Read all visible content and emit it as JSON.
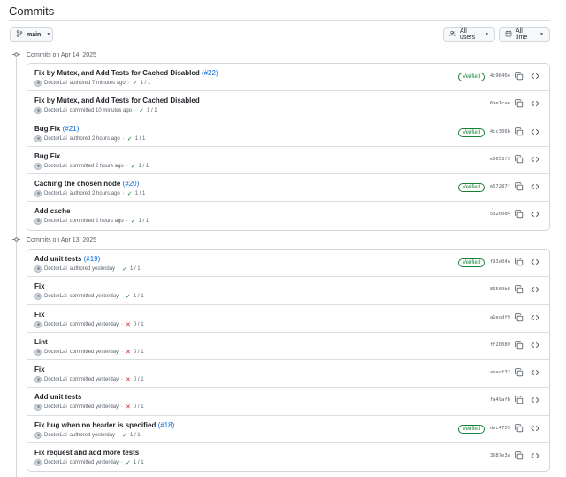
{
  "page": {
    "title": "Commits"
  },
  "toolbar": {
    "branch_label": "main",
    "users_label": "All users",
    "time_label": "All time"
  },
  "colors": {
    "verified": "#1a7f37",
    "success": "#1a7f37",
    "failure": "#cf222e",
    "link": "#0969da"
  },
  "groups": [
    {
      "date_label": "Commits on Apr 14, 2025",
      "commits": [
        {
          "title": "Fix by Mutex, and Add Tests for Cached Disabled",
          "pr": "(#22)",
          "author": "DoctorLai",
          "action": "authored 7 minutes ago",
          "status": "success",
          "check_icon": "✓",
          "checks": "1 / 1",
          "verified": "Verified",
          "sha": "4c9846e"
        },
        {
          "title": "Fix by Mutex, and Add Tests for Cached Disabled",
          "pr": "",
          "author": "DoctorLai",
          "action": "committed 10 minutes ago",
          "status": "success",
          "check_icon": "✓",
          "checks": "1 / 1",
          "verified": "",
          "sha": "6be1cae"
        },
        {
          "title": "Bug Fix",
          "pr": "(#21)",
          "author": "DoctorLai",
          "action": "authored 2 hours ago",
          "status": "success",
          "check_icon": "✓",
          "checks": "1 / 1",
          "verified": "Verified",
          "sha": "4cc306b"
        },
        {
          "title": "Bug Fix",
          "pr": "",
          "author": "DoctorLai",
          "action": "committed 2 hours ago",
          "status": "success",
          "check_icon": "✓",
          "checks": "1 / 1",
          "verified": "",
          "sha": "e0653f3"
        },
        {
          "title": "Caching the chosen node",
          "pr": "(#20)",
          "author": "DoctorLai",
          "action": "authored 2 hours ago",
          "status": "success",
          "check_icon": "✓",
          "checks": "1 / 1",
          "verified": "Verified",
          "sha": "e57287f"
        },
        {
          "title": "Add cache",
          "pr": "",
          "author": "DoctorLai",
          "action": "committed 2 hours ago",
          "status": "success",
          "check_icon": "✓",
          "checks": "1 / 1",
          "verified": "",
          "sha": "53200d4"
        }
      ]
    },
    {
      "date_label": "Commits on Apr 13, 2025",
      "commits": [
        {
          "title": "Add unit tests",
          "pr": "(#19)",
          "author": "DoctorLai",
          "action": "authored yesterday",
          "status": "success",
          "check_icon": "✓",
          "checks": "1 / 1",
          "verified": "Verified",
          "sha": "f93a04a"
        },
        {
          "title": "Fix",
          "pr": "",
          "author": "DoctorLai",
          "action": "committed yesterday",
          "status": "success",
          "check_icon": "✓",
          "checks": "1 / 1",
          "verified": "",
          "sha": "86509b8"
        },
        {
          "title": "Fix",
          "pr": "",
          "author": "DoctorLai",
          "action": "committed yesterday",
          "status": "failure",
          "check_icon": "✕",
          "checks": "0 / 1",
          "verified": "",
          "sha": "a1ecdf9"
        },
        {
          "title": "Lint",
          "pr": "",
          "author": "DoctorLai",
          "action": "committed yesterday",
          "status": "failure",
          "check_icon": "✕",
          "checks": "0 / 1",
          "verified": "",
          "sha": "ff20089"
        },
        {
          "title": "Fix",
          "pr": "",
          "author": "DoctorLai",
          "action": "committed yesterday",
          "status": "failure",
          "check_icon": "✕",
          "checks": "0 / 1",
          "verified": "",
          "sha": "abaaf32"
        },
        {
          "title": "Add unit tests",
          "pr": "",
          "author": "DoctorLai",
          "action": "committed yesterday",
          "status": "failure",
          "check_icon": "✕",
          "checks": "0 / 1",
          "verified": "",
          "sha": "fa49afb"
        },
        {
          "title": "Fix bug when no header is specified",
          "pr": "(#18)",
          "author": "DoctorLai",
          "action": "authored yesterday",
          "status": "success",
          "check_icon": "✓",
          "checks": "1 / 1",
          "verified": "Verified",
          "sha": "dec4755"
        },
        {
          "title": "Fix request and add more tests",
          "pr": "",
          "author": "DoctorLai",
          "action": "committed yesterday",
          "status": "success",
          "check_icon": "✓",
          "checks": "1 / 1",
          "verified": "",
          "sha": "3687e3a"
        }
      ]
    }
  ]
}
